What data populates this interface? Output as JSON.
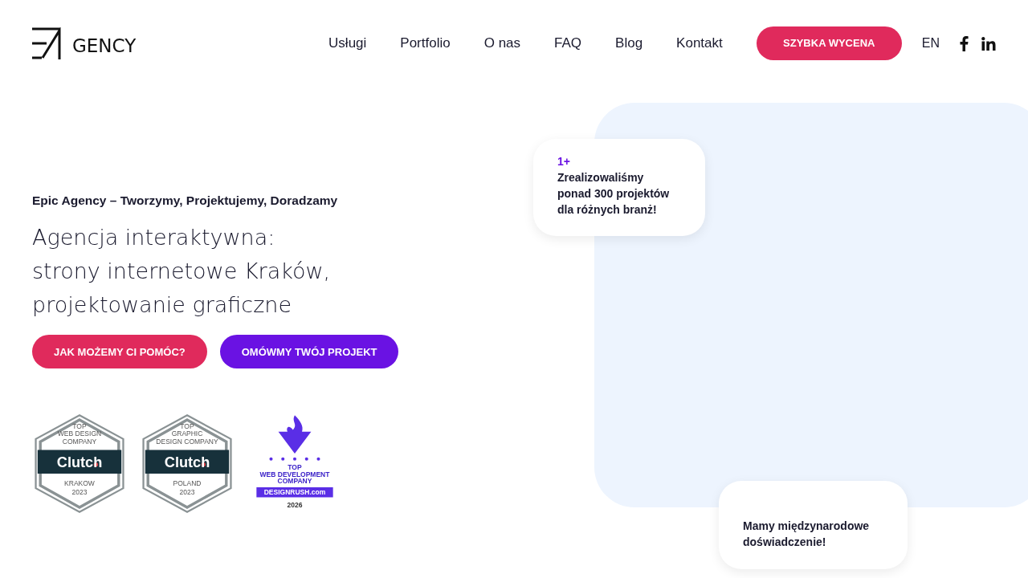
{
  "header": {
    "logo": "GENCY",
    "nav": [
      {
        "label": "Usługi"
      },
      {
        "label": "Portfolio"
      },
      {
        "label": "O nas"
      },
      {
        "label": "FAQ"
      },
      {
        "label": "Blog"
      },
      {
        "label": "Kontakt"
      }
    ],
    "cta": "SZYBKA WYCENA",
    "language": "EN",
    "social": [
      {
        "kind": "facebook"
      },
      {
        "kind": "linkedin"
      }
    ]
  },
  "hero": {
    "eyebrow": "Epic Agency – Tworzymy, Projektujemy, Doradzamy",
    "title_lines": [
      "Agencja interaktywna:",
      "strony internetowe Kraków,",
      "projektowanie graficzne"
    ],
    "buttons": [
      {
        "label": "JAK MOŻEMY CI POMÓC?",
        "color": "#e02a5c"
      },
      {
        "label": "OMÓWMY TWÓJ PROJEKT",
        "color": "#6a12e3"
      }
    ],
    "awards": [
      {
        "kind": "clutch",
        "top_lines": [
          "TOP",
          "WEB DESIGN",
          "COMPANY"
        ],
        "brand": "Clutch",
        "bottom_lines": [
          "KRAKOW",
          "2023"
        ]
      },
      {
        "kind": "clutch",
        "top_lines": [
          "TOP",
          "GRAPHIC",
          "DESIGN COMPANY"
        ],
        "brand": "Clutch",
        "bottom_lines": [
          "POLAND",
          "2023"
        ]
      },
      {
        "kind": "designrush",
        "top_lines": [
          "TOP",
          "WEB DEVELOPMENT",
          "COMPANY"
        ],
        "brand": "DESIGNRUSH.com",
        "bottom_lines": [
          "2026"
        ]
      }
    ]
  },
  "cards": [
    {
      "stat": "1+",
      "text": "Zrealizowaliśmy ponad 300 projektów dla różnych branż!"
    },
    {
      "text": "Mamy międzynarodowe doświadczenie!"
    }
  ]
}
